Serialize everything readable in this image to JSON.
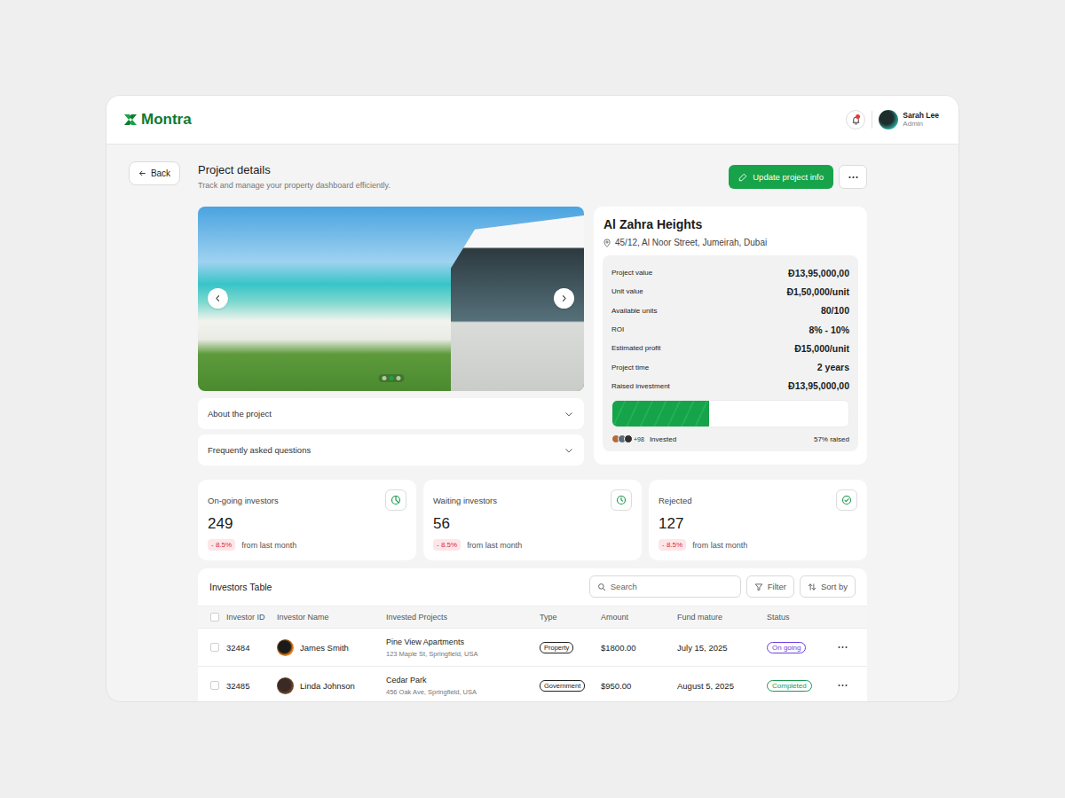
{
  "brand": {
    "name": "Montra"
  },
  "user": {
    "name": "Sarah Lee",
    "role": "Admin",
    "has_notification": true
  },
  "page": {
    "back": "Back",
    "title": "Project details",
    "subtitle": "Track and manage your property dashboard efficiently.",
    "primary_action": "Update project info"
  },
  "gallery": {
    "slides": [
      {
        "selected": false
      },
      {
        "selected": true
      },
      {
        "selected": false
      }
    ]
  },
  "accordions": [
    {
      "label": "About the project",
      "expanded": false
    },
    {
      "label": "Frequently asked questions",
      "expanded": false
    }
  ],
  "project": {
    "name": "Al Zahra Heights",
    "address": "45/12, Al Noor Street, Jumeirah, Dubai",
    "details": [
      {
        "label": "Project value",
        "value": "Đ13,95,000,00"
      },
      {
        "label": "Unit value",
        "value": "Đ1,50,000/unit"
      },
      {
        "label": "Available units",
        "value": "80/100"
      },
      {
        "label": "ROI",
        "value": "8% - 10%"
      },
      {
        "label": "Estimated profit",
        "value": "Đ15,000/unit"
      },
      {
        "label": "Project time",
        "value": "2 years"
      },
      {
        "label": "Raised investment",
        "value": "Đ13,95,000,00"
      }
    ],
    "progress": {
      "level": 0.41,
      "investors_extra": "+98",
      "label": "Invested",
      "reading": "57% raised"
    }
  },
  "stats": [
    {
      "kind": "progress",
      "label": "On-going investors",
      "value": "249",
      "change": "- 8.5%",
      "note": "from last month"
    },
    {
      "kind": "clock",
      "label": "Waiting investors",
      "value": "56",
      "change": "- 8.5%",
      "note": "from last month"
    },
    {
      "kind": "check",
      "label": "Rejected",
      "value": "127",
      "change": "- 8.5%",
      "note": "from last month"
    }
  ],
  "table": {
    "title": "Investors Table",
    "search_placeholder": "Search",
    "filter": "Filter",
    "sort": "Sort by",
    "all_checked": false,
    "columns": [
      "Investor ID",
      "Investor Name",
      "Invested Projects",
      "Type",
      "Amount",
      "Fund mature",
      "Status"
    ],
    "rows": [
      {
        "checked": false,
        "id": "32484",
        "name": "James Smith",
        "project": "Pine View Apartments",
        "address": "123 Maple St, Springfield, USA",
        "type": "Property",
        "amount": "$1800.00",
        "mature": "July 15, 2025",
        "status": "On going",
        "color": "#6d3fe0"
      },
      {
        "checked": false,
        "id": "32485",
        "name": "Linda Johnson",
        "project": "Cedar Park",
        "address": "456 Oak Ave, Springfield, USA",
        "type": "Government",
        "amount": "$950.00",
        "mature": "August 5, 2025",
        "status": "Completed",
        "color": "#1a9a50"
      }
    ]
  }
}
